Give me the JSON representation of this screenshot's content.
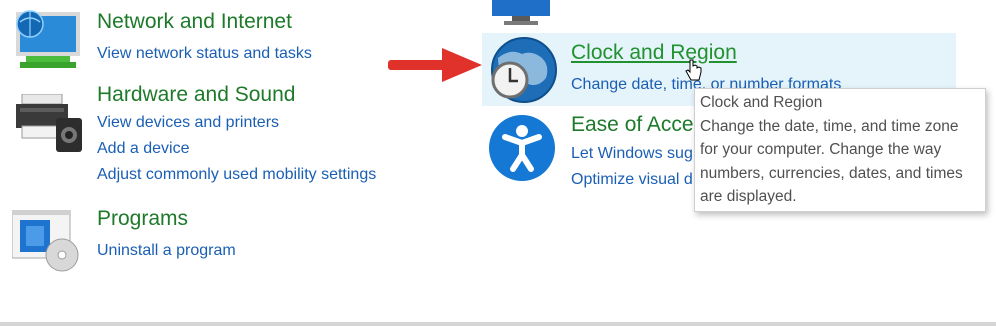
{
  "categories": {
    "network": {
      "title": "Network and Internet",
      "links": [
        "View network status and tasks"
      ],
      "icon": "network-monitor-icon"
    },
    "hardware": {
      "title": "Hardware and Sound",
      "links": [
        "View devices and printers",
        "Add a device",
        "Adjust commonly used mobility settings"
      ],
      "icon": "printer-speaker-icon"
    },
    "programs": {
      "title": "Programs",
      "links": [
        "Uninstall a program"
      ],
      "icon": "programs-disc-icon"
    },
    "clock": {
      "title": "Clock and Region",
      "links": [
        "Change date, time, or number formats"
      ],
      "icon": "globe-clock-icon"
    },
    "ease": {
      "title": "Ease of Acce",
      "links": [
        "Let Windows sug",
        "Optimize visual d"
      ],
      "icon": "accessibility-icon"
    }
  },
  "tooltip": {
    "title": "Clock and Region",
    "lines": [
      "Change the date, time, and time zone",
      "for your computer. Change the way",
      "numbers, currencies, dates, and times",
      "are displayed."
    ]
  },
  "colors": {
    "title_green": "#1e7a2a",
    "link_blue": "#1a5fb4",
    "arrow_red": "#e0312b",
    "hover_bg": "#e5f3fb"
  }
}
